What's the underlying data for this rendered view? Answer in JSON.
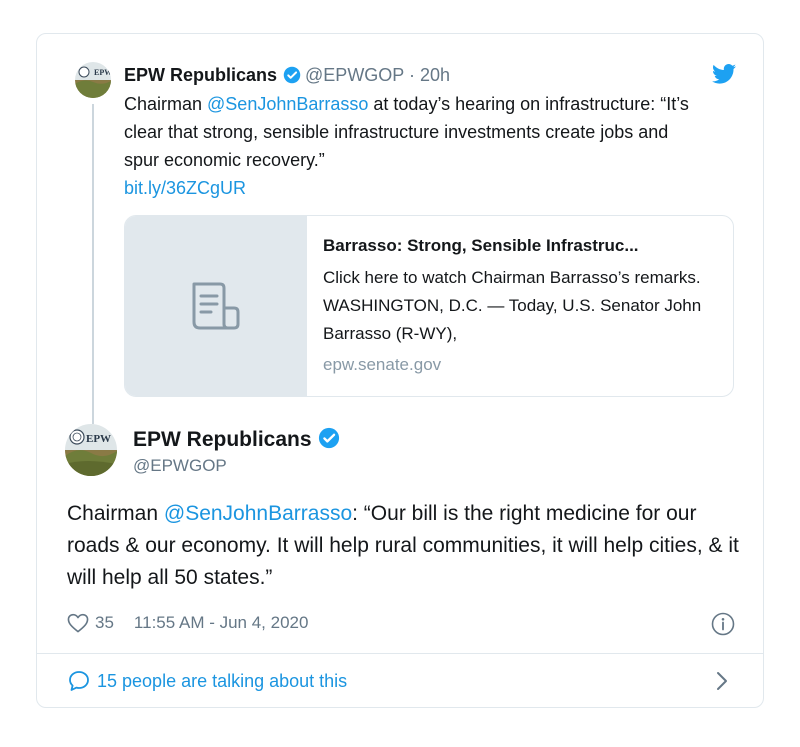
{
  "quoted_tweet": {
    "author_name": "EPW Republicans",
    "handle": "@EPWGOP",
    "separator": "·",
    "time": "20h",
    "text_prefix": "Chairman ",
    "mention": "@SenJohnBarrasso",
    "text_body": " at today’s hearing on infrastructure: “It’s clear that strong, sensible infrastructure investments create jobs and spur economic recovery.”",
    "url": "bit.ly/36ZCgUR",
    "link_card": {
      "title": "Barrasso: Strong, Sensible Infrastruc...",
      "description": "Click here to watch Chairman Barrasso’s remarks. WASHINGTON, D.C. — Today, U.S. Senator John Barrasso (R-WY),",
      "domain": "epw.senate.gov"
    }
  },
  "main_tweet": {
    "author_name": "EPW Republicans",
    "handle": "@EPWGOP",
    "text_prefix": "Chairman ",
    "mention": "@SenJohnBarrasso",
    "text_body": ": “Our bill is the right medicine for our roads & our economy. It will help rural communities, it will help cities, & it will help all 50 states.”",
    "likes": "35",
    "timestamp": "11:55 AM - Jun 4, 2020"
  },
  "footer": {
    "talking": "15 people are talking about this"
  },
  "icons": {
    "verified": "verified-badge-icon",
    "twitter": "twitter-bird-icon",
    "document": "document-icon",
    "heart": "heart-icon",
    "info": "info-icon",
    "comment": "speech-bubble-icon",
    "chevron": "chevron-right-icon"
  },
  "avatar_logo_text": "EPW",
  "colors": {
    "link": "#1b95e0",
    "muted": "#657786",
    "border": "#e1e8ed",
    "verified": "#1da1f2"
  }
}
